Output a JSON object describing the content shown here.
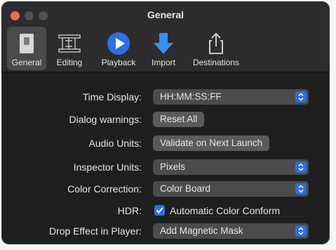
{
  "window": {
    "title": "General"
  },
  "toolbar": {
    "tabs": [
      {
        "label": "General",
        "icon": "general-switch-icon",
        "selected": true
      },
      {
        "label": "Editing",
        "icon": "film-strip-icon",
        "selected": false
      },
      {
        "label": "Playback",
        "icon": "play-icon",
        "selected": false
      },
      {
        "label": "Import",
        "icon": "down-arrow-icon",
        "selected": false
      },
      {
        "label": "Destinations",
        "icon": "share-icon",
        "selected": false
      }
    ]
  },
  "settings": {
    "time_display": {
      "label": "Time Display:",
      "value": "HH:MM:SS:FF"
    },
    "dialog_warnings": {
      "label": "Dialog warnings:",
      "button": "Reset All"
    },
    "audio_units": {
      "label": "Audio Units:",
      "button": "Validate on Next Launch"
    },
    "inspector_units": {
      "label": "Inspector Units:",
      "value": "Pixels"
    },
    "color_correction": {
      "label": "Color Correction:",
      "value": "Color Board"
    },
    "hdr": {
      "label": "HDR:",
      "checkbox_label": "Automatic Color Conform",
      "checked": true
    },
    "drop_effect": {
      "label": "Drop Effect in Player:",
      "value": "Add Magnetic Mask"
    }
  },
  "colors": {
    "accent": "#2f6fe0",
    "close": "#ec6a5e",
    "window_bg": "#1e1e1e",
    "toolbar_bg": "#2c2c2e"
  }
}
